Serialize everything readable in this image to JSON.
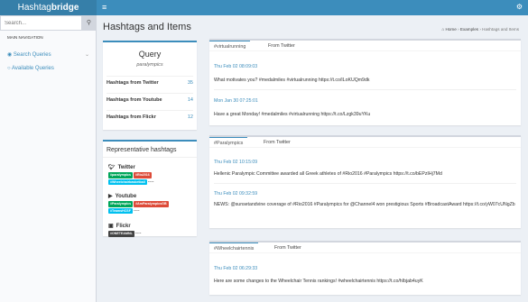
{
  "header": {
    "logo_light": "Hashtag",
    "logo_bold": "bridge",
    "menu_icon": "hamburger-icon",
    "settings_icon": "gears-icon"
  },
  "sidebar": {
    "search": {
      "placeholder": "Search..."
    },
    "nav_header": "MAIN NAVIGATION",
    "items": [
      {
        "label": "Search Queries",
        "icon": "dashboard-icon"
      },
      {
        "label": "Available Queries",
        "icon": "circle-icon"
      }
    ]
  },
  "page": {
    "title": "Hashtags and Items",
    "breadcrumb": [
      "Home",
      "Examples",
      "Hashtags and Items"
    ]
  },
  "query": {
    "title": "Query",
    "value": "paralympics",
    "rows": [
      {
        "label": "Hashtags from Twitter",
        "count": "35"
      },
      {
        "label": "Hashtags from Youtube",
        "count": "14"
      },
      {
        "label": "Hashtags from Flickr",
        "count": "12"
      }
    ]
  },
  "representative": {
    "title": "Representative hashtags",
    "sources": [
      {
        "name": "Twitter",
        "icon": "twitter-icon",
        "tags": [
          "#paralympics",
          "#Rio2016",
          "#Wheelchairbasketball"
        ],
        "trailer": "----"
      },
      {
        "name": "Youtube",
        "icon": "youtube-icon",
        "tags": [
          "#Paralympics",
          "#AmParalympicsGB",
          "#TeamsHCSF"
        ],
        "trailer": "----"
      },
      {
        "name": "Flickr",
        "icon": "flickr-icon",
        "tags": [
          "#ONETEAMNL"
        ],
        "trailer": "----"
      }
    ]
  },
  "panels": [
    {
      "tab_hashtag": "#virtualrunning",
      "tab_source": "From Twitter",
      "posts": [
        {
          "date": "Thu Feb 02 08:09:03",
          "text": "What motivates you? #medalmiles #virtualrunning https://t.co/ILoKUQm9dk"
        },
        {
          "date": "Mon Jan 30 07:25:01",
          "text": "Have a great Monday! #medalmiles #virtualrunning https://t.co/Lzgk39uYKu"
        }
      ]
    },
    {
      "tab_hashtag": "#Paralympics",
      "tab_source": "From Twitter",
      "posts": [
        {
          "date": "Thu Feb 02 10:15:09",
          "text": "Hellenic Paralympic Committee awarded all Greek athletes of #Rio2016 #Paralympics https://t.co/bEPzIHj7Md"
        },
        {
          "date": "Thu Feb 02 09:32:59",
          "text": "NEWS: @sunsetandvine coverage of #Rio2016 #Paralympics for @Channel4 won prestigious Sports #BroadcastAward https://t.co/yW07cUNgZb"
        }
      ]
    },
    {
      "tab_hashtag": "#Wheelchairtennis",
      "tab_source": "From Twitter",
      "posts": [
        {
          "date": "Thu Feb 02 06:29:33",
          "text": "Here are some changes to the Wheelchair Tennis rankings! #wheelchairtennis https://t.co/hIbjab4uyK"
        }
      ]
    }
  ]
}
